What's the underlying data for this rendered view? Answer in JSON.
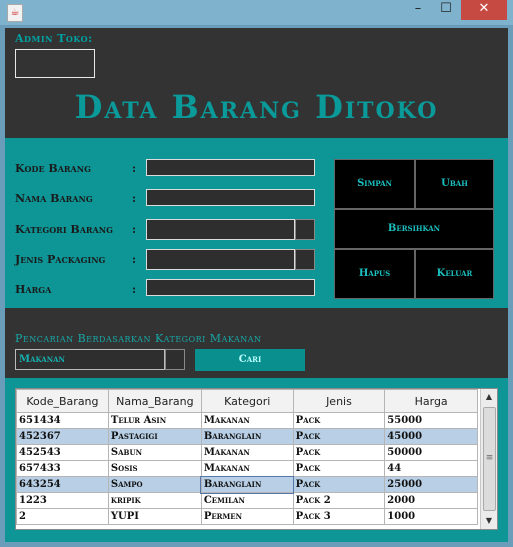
{
  "window": {
    "close_glyph": "✕",
    "min_glyph": "–",
    "max_glyph": "☐",
    "app_icon": "☕"
  },
  "header": {
    "admin_label": "Admin Toko:",
    "admin_value": "",
    "title": "Data Barang Ditoko"
  },
  "form": {
    "fields": [
      {
        "label": "Kode Barang",
        "sep": ":",
        "value": ""
      },
      {
        "label": "Nama Barang",
        "sep": ":",
        "value": ""
      },
      {
        "label": "Kategori Barang",
        "sep": ":",
        "value": ""
      },
      {
        "label": "Jenis Packaging",
        "sep": ":",
        "value": ""
      },
      {
        "label": "Harga",
        "sep": ":",
        "value": ""
      }
    ]
  },
  "buttons": {
    "simpan": "Simpan",
    "ubah": "Ubah",
    "bersihkan": "Bersihkan",
    "hapus": "Hapus",
    "keluar": "Keluar"
  },
  "search": {
    "label": "Pencarian Berdasarkan Kategori Makanan",
    "selected": "Makanan",
    "button": "Cari"
  },
  "table": {
    "headers": [
      "Kode_Barang",
      "Nama_Barang",
      "Kategori",
      "Jenis",
      "Harga"
    ],
    "rows": [
      [
        "651434",
        "Telur Asin",
        "Makanan",
        "Pack",
        "55000"
      ],
      [
        "452367",
        "Pastagigi",
        "Baranglain",
        "Pack",
        "45000"
      ],
      [
        "452543",
        "Sabun",
        "Makanan",
        "Pack",
        "50000"
      ],
      [
        "657433",
        "Sosis",
        "Makanan",
        "Pack",
        "44"
      ],
      [
        "643254",
        "Sampo",
        "Baranglain",
        "Pack",
        "25000"
      ],
      [
        "1223",
        "kripik",
        "Cemilan",
        "Pack 2",
        "2000"
      ],
      [
        "2",
        "YUPI",
        "Permen",
        "Pack 3",
        "1000"
      ]
    ]
  },
  "scrollbar": {
    "up": "▲",
    "down": "▼",
    "grip": "≡"
  }
}
